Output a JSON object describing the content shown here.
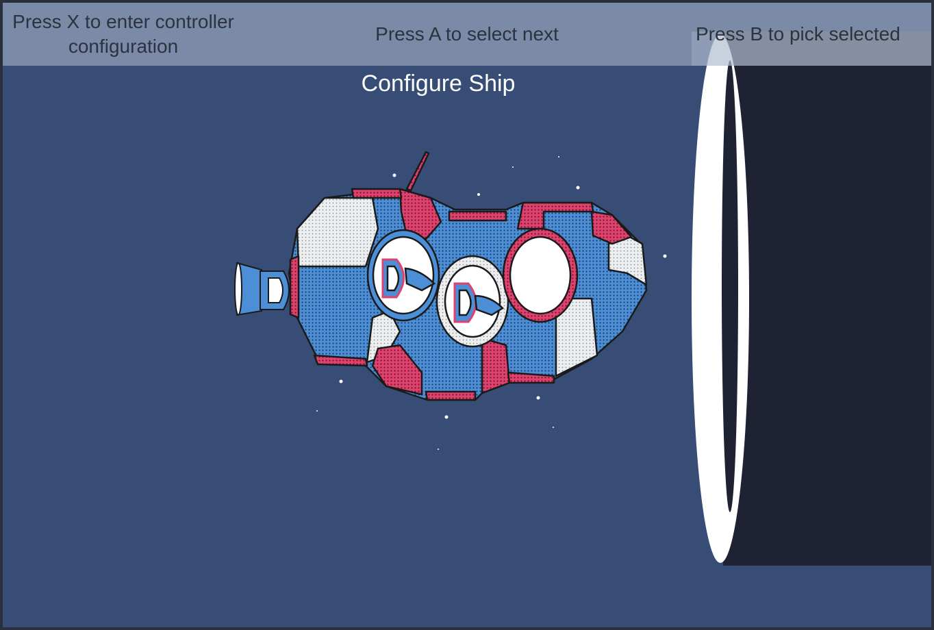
{
  "hints": {
    "controller_config": "Press X to enter controller configuration",
    "select_next": "Press A to select next",
    "pick_selected": "Press B to pick selected"
  },
  "screen_title": "Configure Ship",
  "colors": {
    "background": "#384d75",
    "hint_bar": "#a9b4c8",
    "hull_blue": "#4c8fd6",
    "hull_pink": "#e0426e",
    "hull_white": "#e8eaed",
    "side_panel": "#1e2233"
  }
}
